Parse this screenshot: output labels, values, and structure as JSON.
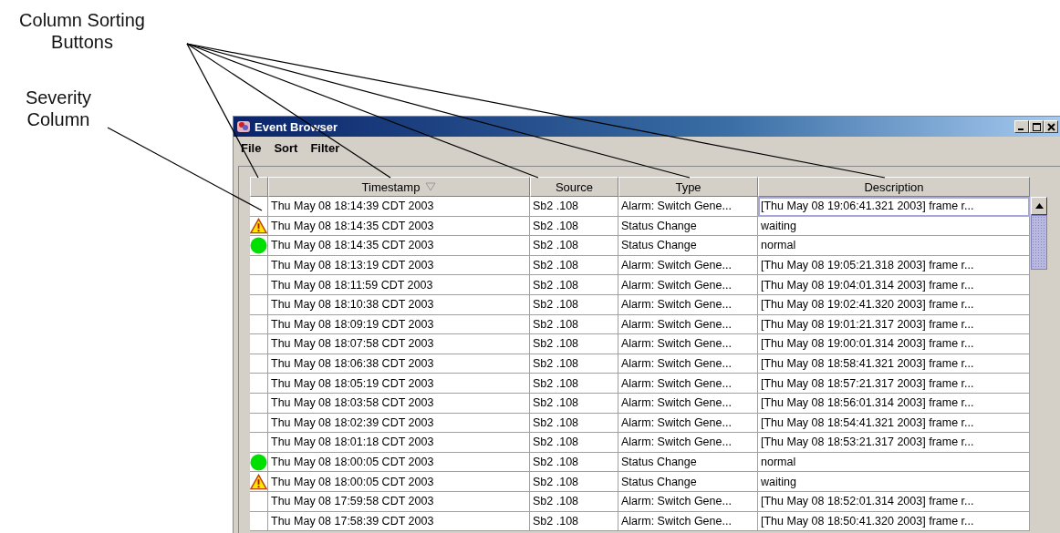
{
  "annotations": [
    {
      "text": "Column Sorting Buttons"
    },
    {
      "text": "Severity Column"
    }
  ],
  "window": {
    "title": "Event Browser"
  },
  "menu": [
    "File",
    "Sort",
    "Filter"
  ],
  "table": {
    "columns": [
      {
        "label": "Timestamp",
        "sorted": true
      },
      {
        "label": "Source",
        "sorted": false
      },
      {
        "label": "Type",
        "sorted": false
      },
      {
        "label": "Description",
        "sorted": false
      }
    ],
    "rows": [
      {
        "kind": "plain",
        "focused": true,
        "cells": [
          "Thu May 08 18:14:39 CDT 2003",
          "Sb2 .108",
          "Alarm: Switch Gene...",
          "[Thu May 08 19:06:41.321 2003] frame r..."
        ]
      },
      {
        "kind": "warning",
        "focused": false,
        "cells": [
          "Thu May 08 18:14:35 CDT 2003",
          "Sb2 .108",
          "Status Change",
          "waiting"
        ]
      },
      {
        "kind": "normal",
        "focused": false,
        "cells": [
          "Thu May 08 18:14:35 CDT 2003",
          "Sb2 .108",
          "Status Change",
          "normal"
        ]
      },
      {
        "kind": "plain",
        "focused": false,
        "cells": [
          "Thu May 08 18:13:19 CDT 2003",
          "Sb2 .108",
          "Alarm: Switch Gene...",
          "[Thu May 08 19:05:21.318 2003] frame r..."
        ]
      },
      {
        "kind": "plain",
        "focused": false,
        "cells": [
          "Thu May 08 18:11:59 CDT 2003",
          "Sb2 .108",
          "Alarm: Switch Gene...",
          "[Thu May 08 19:04:01.314 2003] frame r..."
        ]
      },
      {
        "kind": "plain",
        "focused": false,
        "cells": [
          "Thu May 08 18:10:38 CDT 2003",
          "Sb2 .108",
          "Alarm: Switch Gene...",
          "[Thu May 08 19:02:41.320 2003] frame r..."
        ]
      },
      {
        "kind": "plain",
        "focused": false,
        "cells": [
          "Thu May 08 18:09:19 CDT 2003",
          "Sb2 .108",
          "Alarm: Switch Gene...",
          "[Thu May 08 19:01:21.317 2003] frame r..."
        ]
      },
      {
        "kind": "plain",
        "focused": false,
        "cells": [
          "Thu May 08 18:07:58 CDT 2003",
          "Sb2 .108",
          "Alarm: Switch Gene...",
          "[Thu May 08 19:00:01.314 2003] frame r..."
        ]
      },
      {
        "kind": "plain",
        "focused": false,
        "cells": [
          "Thu May 08 18:06:38 CDT 2003",
          "Sb2 .108",
          "Alarm: Switch Gene...",
          "[Thu May 08 18:58:41.321 2003] frame r..."
        ]
      },
      {
        "kind": "plain",
        "focused": false,
        "cells": [
          "Thu May 08 18:05:19 CDT 2003",
          "Sb2 .108",
          "Alarm: Switch Gene...",
          "[Thu May 08 18:57:21.317 2003] frame r..."
        ]
      },
      {
        "kind": "plain",
        "focused": false,
        "cells": [
          "Thu May 08 18:03:58 CDT 2003",
          "Sb2 .108",
          "Alarm: Switch Gene...",
          "[Thu May 08 18:56:01.314 2003] frame r..."
        ]
      },
      {
        "kind": "plain",
        "focused": false,
        "cells": [
          "Thu May 08 18:02:39 CDT 2003",
          "Sb2 .108",
          "Alarm: Switch Gene...",
          "[Thu May 08 18:54:41.321 2003] frame r..."
        ]
      },
      {
        "kind": "plain",
        "focused": false,
        "cells": [
          "Thu May 08 18:01:18 CDT 2003",
          "Sb2 .108",
          "Alarm: Switch Gene...",
          "[Thu May 08 18:53:21.317 2003] frame r..."
        ]
      },
      {
        "kind": "normal",
        "focused": false,
        "cells": [
          "Thu May 08 18:00:05 CDT 2003",
          "Sb2 .108",
          "Status Change",
          "normal"
        ]
      },
      {
        "kind": "warning",
        "focused": false,
        "cells": [
          "Thu May 08 18:00:05 CDT 2003",
          "Sb2 .108",
          "Status Change",
          "waiting"
        ]
      },
      {
        "kind": "plain",
        "focused": false,
        "cells": [
          "Thu May 08 17:59:58 CDT 2003",
          "Sb2 .108",
          "Alarm: Switch Gene...",
          "[Thu May 08 18:52:01.314 2003] frame r..."
        ]
      },
      {
        "kind": "plain",
        "focused": false,
        "cells": [
          "Thu May 08 17:58:39 CDT 2003",
          "Sb2 .108",
          "Alarm: Switch Gene...",
          "[Thu May 08 18:50:41.320 2003] frame r..."
        ]
      }
    ]
  }
}
